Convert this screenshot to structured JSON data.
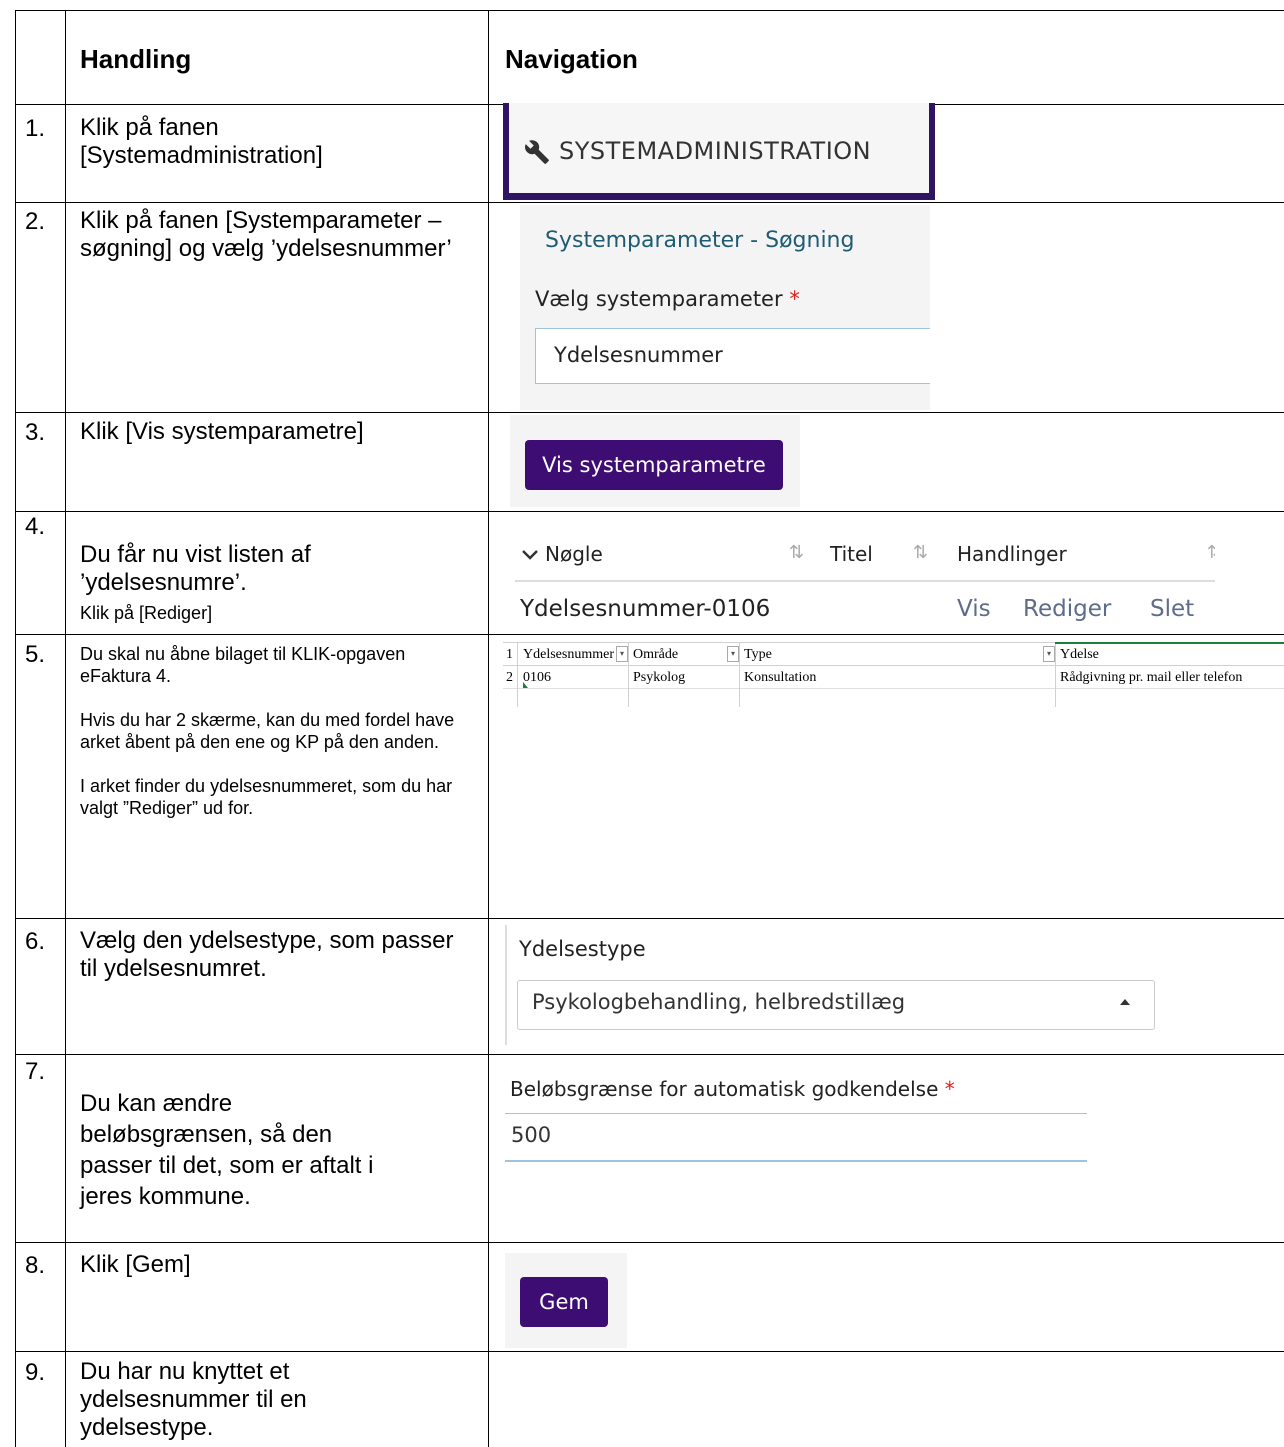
{
  "header": {
    "col_action": "Handling",
    "col_nav": "Navigation"
  },
  "steps": [
    {
      "num": "1.",
      "text": "Klik på fanen [Systemadministration]"
    },
    {
      "num": "2.",
      "text": "Klik på fanen [Systemparameter – søgning] og vælg ’ydelsesnummer’"
    },
    {
      "num": "3.",
      "text": "Klik [Vis systemparametre]"
    },
    {
      "num": "4.",
      "text": "Du får nu vist listen af ’ydelsesnumre’.",
      "sub": "Klik på [Rediger]"
    },
    {
      "num": "5.",
      "p1": "Du skal nu åbne bilaget til KLIK-opgaven eFaktura 4.",
      "p2": "Hvis du har 2 skærme, kan du med fordel have arket åbent på den ene og KP på den anden.",
      "p3": "I arket finder du ydelsesnummeret, som du har valgt ”Rediger” ud for."
    },
    {
      "num": "6.",
      "text": "Vælg den ydelsestype, som passer til ydelsesnumret."
    },
    {
      "num": "7.",
      "text": "Du kan ændre beløbsgrænsen, så den passer til det, som er aftalt i jeres kommune."
    },
    {
      "num": "8.",
      "text": "Klik [Gem]"
    },
    {
      "num": "9.",
      "text": "Du har nu knyttet et ydelsesnummer til en ydelsestype."
    }
  ],
  "shot1": {
    "tab_label": "SYSTEMADMINISTRATION",
    "icon": "wrench-icon"
  },
  "shot2": {
    "title": "Systemparameter - Søgning",
    "label": "Vælg systemparameter",
    "required": "*",
    "value": "Ydelsesnummer"
  },
  "shot3": {
    "button": "Vis systemparametre"
  },
  "shot4": {
    "col_key": "Nøgle",
    "col_title": "Titel",
    "col_actions": "Handlinger",
    "row_key": "Ydelsesnummer-0106",
    "action_view": "Vis",
    "action_edit": "Rediger",
    "action_delete": "Slet"
  },
  "shot5": {
    "rows": [
      {
        "n": "1",
        "cells": [
          "Ydelsesnummer",
          "Område",
          "Type",
          "Ydelse"
        ]
      },
      {
        "n": "2",
        "cells": [
          "0106",
          "Psykolog",
          "Konsultation",
          "Rådgivning pr. mail eller telefon"
        ]
      }
    ]
  },
  "shot6": {
    "label": "Ydelsestype",
    "value": "Psykologbehandling, helbredstillæg"
  },
  "shot7": {
    "label": "Beløbsgrænse for automatisk godkendelse",
    "required": "*",
    "value": "500"
  },
  "shot8": {
    "button": "Gem"
  },
  "colors": {
    "purple": "#3d0d73",
    "tab_border": "#2e1463",
    "required": "#e0201f",
    "title_teal": "#1f5c74"
  }
}
